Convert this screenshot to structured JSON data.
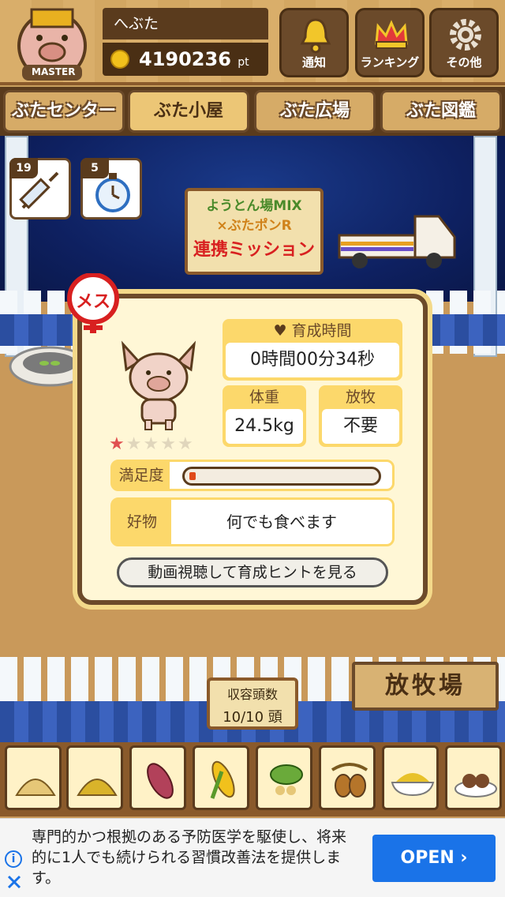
{
  "header": {
    "username": "へぶた",
    "points": "4190236",
    "points_unit": "pt",
    "badge_text": "MASTER",
    "buttons": {
      "notify": "通知",
      "ranking": "ランキング",
      "other": "その他"
    }
  },
  "tabs": [
    {
      "label": "ぶたセンター",
      "active": false
    },
    {
      "label": "ぶた小屋",
      "active": true
    },
    {
      "label": "ぶた広場",
      "active": false
    },
    {
      "label": "ぶた図鑑",
      "active": false
    }
  ],
  "items": {
    "syringe_count": "19",
    "timer_count": "5"
  },
  "mission_sign": {
    "line1": "ようとん場MIX",
    "line2": "×ぶたポンR",
    "line3": "連携ミッション"
  },
  "pig": {
    "gender": "メス",
    "rearing_time_label": "育成時間",
    "rearing_time_value": "0時間00分34秒",
    "weight_label": "体重",
    "weight_value": "24.5kg",
    "grazing_label": "放牧",
    "grazing_value": "不要",
    "stars_filled": 1,
    "stars_total": 5,
    "satisfaction_label": "満足度",
    "satisfaction_level": 0.03,
    "favorite_label": "好物",
    "favorite_value": "何でも食べます",
    "hint_button": "動画視聴して育成ヒントを見る"
  },
  "capacity": {
    "label": "収容頭数",
    "value": "10/10 頭"
  },
  "pasture_sign": "放牧場",
  "foods": [
    "soybeans-icon",
    "grain-icon",
    "sweet-potato-icon",
    "corn-icon",
    "vegetable-icon",
    "acorn-icon",
    "rice-bowl-icon",
    "meat-dish-icon"
  ],
  "ad": {
    "text": "専門的かつ根拠のある予防医学を駆使し、将来的に1人でも続けられる習慣改善法を提供します。",
    "button": "OPEN ›"
  },
  "colors": {
    "wood_dark": "#5a3b1d",
    "wood_light": "#d6ab67",
    "panel_yellow": "#fcd86b",
    "ad_blue": "#1a73e8",
    "gender_red": "#d82020"
  }
}
